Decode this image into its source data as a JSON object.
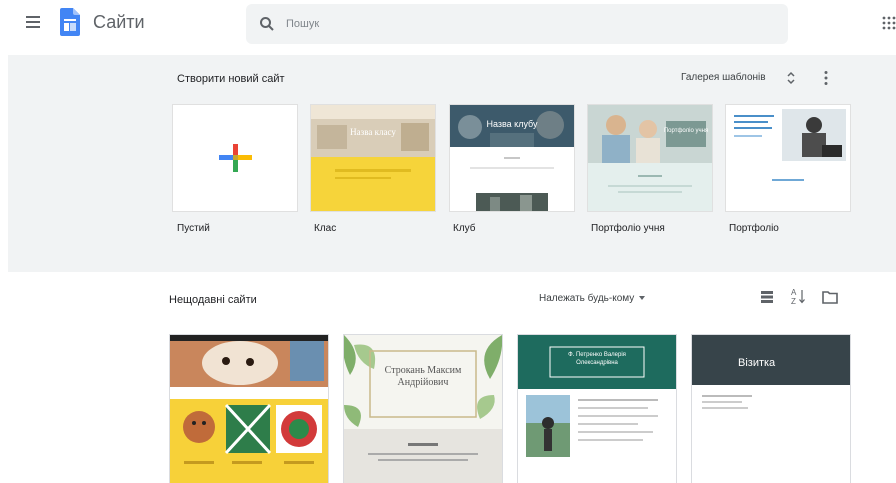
{
  "header": {
    "app_title": "Сайти",
    "search_placeholder": "Пошук"
  },
  "templates": {
    "section_title": "Створити новий сайт",
    "gallery_label": "Галерея шаблонів",
    "items": [
      {
        "label": "Пустий"
      },
      {
        "label": "Клас",
        "thumb_title": "Назва класу"
      },
      {
        "label": "Клуб",
        "thumb_title": "Назва клубу"
      },
      {
        "label": "Портфоліо учня",
        "thumb_title": "Портфоліо учня"
      },
      {
        "label": "Портфоліо"
      }
    ]
  },
  "recent": {
    "section_title": "Нещодавні сайти",
    "owner_filter": "Належать будь-кому",
    "sites": [
      {
        "thumb_title": ""
      },
      {
        "thumb_title": "Строкань Максим Андрійович"
      },
      {
        "thumb_title": "Ф. Петренко Валерія Олександрівна"
      },
      {
        "thumb_title": "Візитка"
      }
    ]
  },
  "colors": {
    "brand_blue": "#4285f4",
    "google_red": "#ea4335",
    "google_yellow": "#fbbc04",
    "google_green": "#34a853",
    "panel_bg": "#f1f3f4"
  }
}
